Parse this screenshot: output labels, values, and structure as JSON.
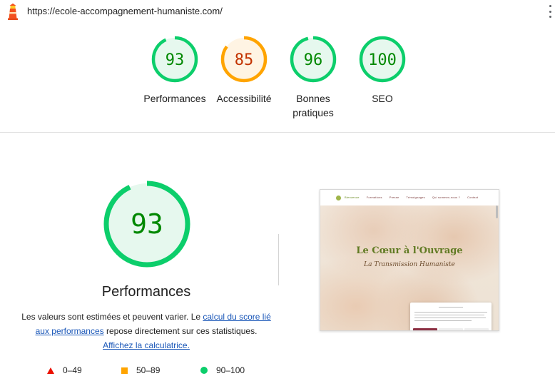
{
  "url_bar": {
    "url": "https://ecole-accompagnement-humaniste.com/"
  },
  "colors": {
    "pass": "#0cce6b",
    "pass_text": "#008800",
    "pass_bg": "#e6f8ee",
    "average": "#ffa400",
    "average_text": "#c33300",
    "average_bg": "#fff4e3",
    "fail": "#eb0f00",
    "link": "#1a57b8"
  },
  "summary_gauges": [
    {
      "score": 93,
      "label": "Performances",
      "status": "pass"
    },
    {
      "score": 85,
      "label": "Accessibilité",
      "status": "average"
    },
    {
      "score": 96,
      "label": "Bonnes pratiques",
      "status": "pass"
    },
    {
      "score": 100,
      "label": "SEO",
      "status": "pass"
    }
  ],
  "performance": {
    "score": 93,
    "title": "Performances",
    "desc_text_1": "Les valeurs sont estimées et peuvent varier. Le ",
    "desc_link_1": "calcul du score lié aux performances",
    "desc_text_2": " repose directement sur ces statistiques. ",
    "desc_link_2": "Affichez la calculatrice."
  },
  "legend": [
    {
      "icon": "triangle-icon",
      "range": "0–49"
    },
    {
      "icon": "square-icon",
      "range": "50–89"
    },
    {
      "icon": "circle-icon",
      "range": "90–100"
    }
  ],
  "thumbnail": {
    "nav_items": [
      "Bienvenue",
      "Formations",
      "Presse",
      "Témoignages",
      "Qui sommes-nous ?",
      "Contact"
    ],
    "hero_title": "Le Cœur à l'Ouvrage",
    "hero_subtitle": "La Transmission Humaniste"
  }
}
